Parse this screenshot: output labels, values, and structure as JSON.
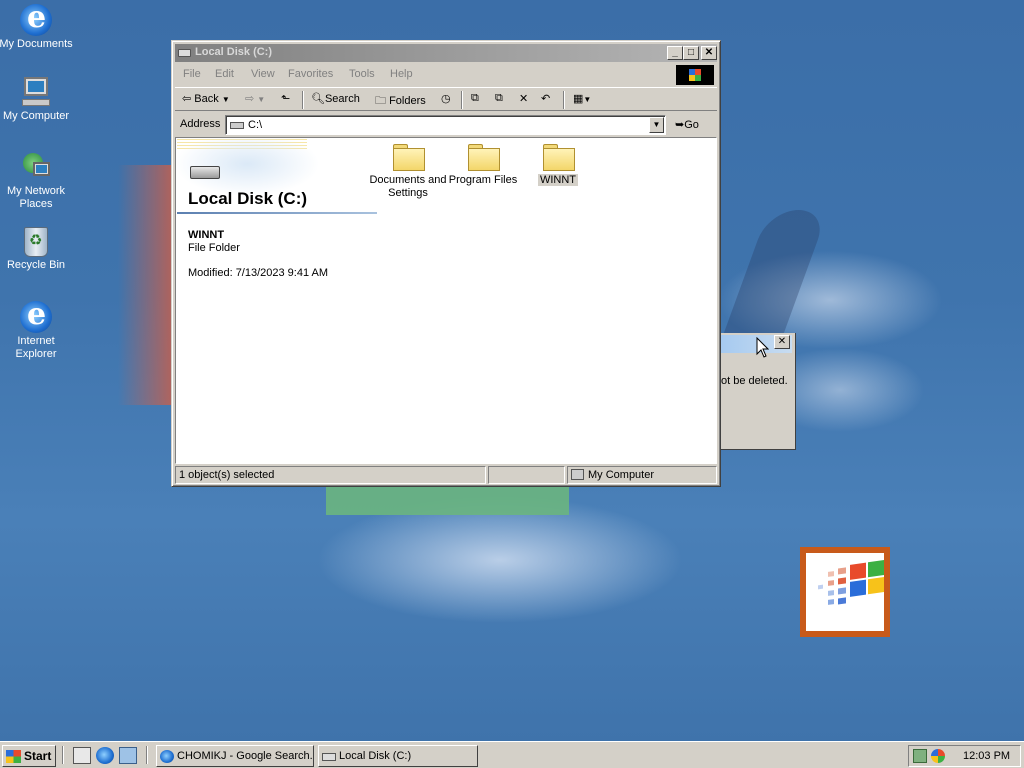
{
  "desktop": {
    "icons": [
      {
        "label": "My Documents",
        "icon": "ie-icon"
      },
      {
        "label": "My Computer",
        "icon": "computer-icon"
      },
      {
        "label": "My Network Places",
        "icon": "network-icon"
      },
      {
        "label": "Recycle Bin",
        "icon": "recycle-bin-icon"
      },
      {
        "label": "Internet Explorer",
        "icon": "ie-icon"
      }
    ]
  },
  "window": {
    "title": "Local Disk (C:)",
    "controls": {
      "minimize": "_",
      "maximize": "□",
      "close": "✕"
    },
    "menu": [
      "File",
      "Edit",
      "View",
      "Favorites",
      "Tools",
      "Help"
    ],
    "toolbar": {
      "back": "Back",
      "search": "Search",
      "folders": "Folders"
    },
    "address": {
      "label": "Address",
      "value": "C:\\",
      "go": "Go"
    },
    "content": {
      "title": "Local Disk (C:)",
      "selected": {
        "name": "WINNT",
        "type": "File Folder",
        "modified": "Modified: 7/13/2023 9:41 AM"
      },
      "folders": [
        {
          "label": "Documents and Settings",
          "selected": false
        },
        {
          "label": "Program Files",
          "selected": false
        },
        {
          "label": "WINNT",
          "selected": true
        }
      ]
    },
    "status": {
      "selection": "1 object(s) selected",
      "zone": "My Computer"
    }
  },
  "dialog": {
    "message": "ot be deleted.",
    "close": "✕"
  },
  "taskbar": {
    "start": "Start",
    "tasks": [
      {
        "label": "CHOMIKJ - Google Search...",
        "icon": "ie-icon"
      },
      {
        "label": "Local Disk (C:)",
        "icon": "drive-icon"
      }
    ],
    "clock": "12:03 PM"
  },
  "colors": {
    "desktop": "#3a6ea5",
    "title_inactive": "#808080",
    "face": "#d4d0c8"
  }
}
